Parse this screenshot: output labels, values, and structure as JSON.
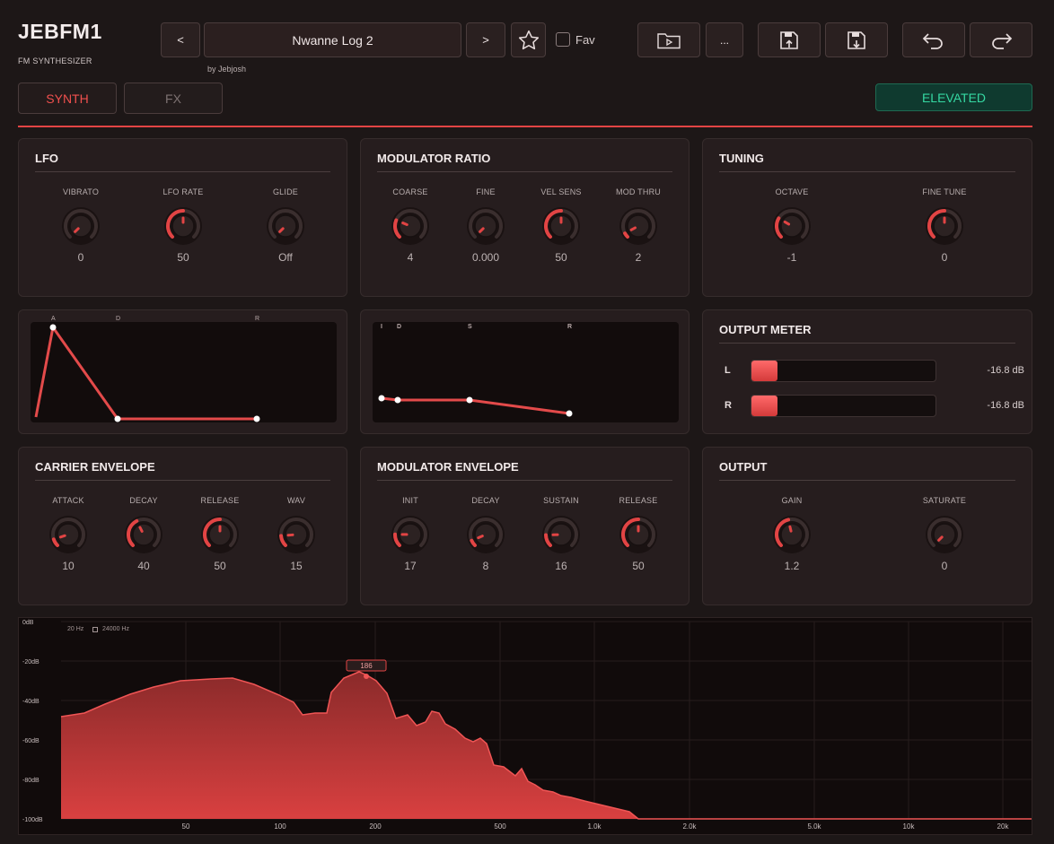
{
  "header": {
    "app_name": "JEBFM1",
    "app_subtitle": "FM SYNTHESIZER",
    "preset_name": "Nwanne Log 2",
    "author": "by Jebjosh",
    "prev_label": "<",
    "next_label": ">",
    "fav_label": "Fav",
    "more_label": "..."
  },
  "tabs": {
    "synth": "SYNTH",
    "fx": "FX"
  },
  "mode_badge": "ELEVATED",
  "lfo": {
    "title": "LFO",
    "knobs": [
      {
        "label": "VIBRATO",
        "value": "0",
        "fill": 0.0
      },
      {
        "label": "LFO RATE",
        "value": "50",
        "fill": 0.5
      },
      {
        "label": "GLIDE",
        "value": "Off",
        "fill": 0.0
      }
    ]
  },
  "mod_ratio": {
    "title": "MODULATOR RATIO",
    "knobs": [
      {
        "label": "COARSE",
        "value": "4",
        "fill": 0.25
      },
      {
        "label": "FINE",
        "value": "0.000",
        "fill": 0.0
      },
      {
        "label": "VEL SENS",
        "value": "50",
        "fill": 0.5
      },
      {
        "label": "MOD THRU",
        "value": "2",
        "fill": 0.06
      }
    ]
  },
  "tuning": {
    "title": "TUNING",
    "knobs": [
      {
        "label": "OCTAVE",
        "value": "-1",
        "fill": 0.28
      },
      {
        "label": "FINE TUNE",
        "value": "0",
        "fill": 0.5
      }
    ]
  },
  "carrier_env_graph": {
    "labels": [
      "A",
      "D",
      "R"
    ]
  },
  "mod_env_graph": {
    "labels": [
      "I",
      "D",
      "S",
      "R"
    ]
  },
  "output_meter": {
    "title": "OUTPUT METER",
    "channels": [
      {
        "label": "L",
        "value": "-16.8 dB",
        "level": 0.14
      },
      {
        "label": "R",
        "value": "-16.8 dB",
        "level": 0.14
      }
    ]
  },
  "carrier_env": {
    "title": "CARRIER ENVELOPE",
    "knobs": [
      {
        "label": "ATTACK",
        "value": "10",
        "fill": 0.1
      },
      {
        "label": "DECAY",
        "value": "40",
        "fill": 0.4
      },
      {
        "label": "RELEASE",
        "value": "50",
        "fill": 0.5
      },
      {
        "label": "WAV",
        "value": "15",
        "fill": 0.15
      }
    ]
  },
  "mod_env": {
    "title": "MODULATOR ENVELOPE",
    "knobs": [
      {
        "label": "INIT",
        "value": "17",
        "fill": 0.17
      },
      {
        "label": "DECAY",
        "value": "8",
        "fill": 0.08
      },
      {
        "label": "SUSTAIN",
        "value": "16",
        "fill": 0.16
      },
      {
        "label": "RELEASE",
        "value": "50",
        "fill": 0.5
      }
    ]
  },
  "output": {
    "title": "OUTPUT",
    "knobs": [
      {
        "label": "GAIN",
        "value": "1.2",
        "fill": 0.45
      },
      {
        "label": "SATURATE",
        "value": "0",
        "fill": 0.0
      }
    ]
  },
  "spectrum": {
    "range_low": "20 Hz",
    "range_high": "24000 Hz",
    "peak_label": "186",
    "y_ticks": [
      "0dB",
      "-20dB",
      "-40dB",
      "-60dB",
      "-80dB",
      "-100dB"
    ],
    "x_ticks": [
      "50",
      "100",
      "200",
      "500",
      "1.0k",
      "2.0k",
      "5.0k",
      "10k",
      "20k"
    ],
    "colors": {
      "fill": "#d94040",
      "line": "#f05555"
    }
  },
  "colors": {
    "accent": "#e24444",
    "knob_track": "#3a2e2e",
    "badge_text": "#35d8a2"
  }
}
